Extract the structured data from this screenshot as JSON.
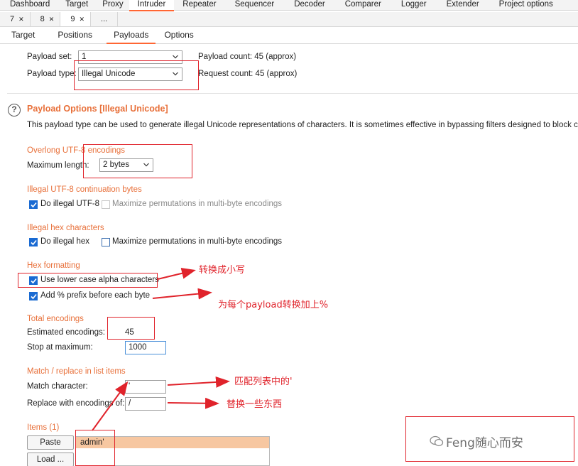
{
  "top_tabs": [
    "Dashboard",
    "Target",
    "Proxy",
    "Intruder",
    "Repeater",
    "Sequencer",
    "Decoder",
    "Comparer",
    "Logger",
    "Extender",
    "Project options"
  ],
  "num_tabs": [
    "7",
    "8",
    "9",
    "..."
  ],
  "inner_tabs": [
    "Target",
    "Positions",
    "Payloads",
    "Options"
  ],
  "payload_set": {
    "label": "Payload set:",
    "value": "1"
  },
  "payload_type": {
    "label": "Payload type:",
    "value": "Illegal Unicode"
  },
  "payload_count": "Payload count:  45 (approx)",
  "request_count": "Request count:  45 (approx)",
  "options": {
    "title": "Payload Options [Illegal Unicode]",
    "description": "This payload type can be used to generate illegal Unicode representations of characters. It is sometimes effective in bypassing filters designed to block certai"
  },
  "overlong": {
    "heading": "Overlong UTF-8 encodings",
    "max_label": "Maximum length:",
    "max_value": "2 bytes"
  },
  "continuation": {
    "heading": "Illegal UTF-8 continuation bytes",
    "do_label": "Do illegal UTF-8",
    "max_perm_label": "Maximize permutations in multi-byte encodings"
  },
  "hex_chars": {
    "heading": "Illegal hex characters",
    "do_label": "Do illegal hex",
    "max_perm_label": "Maximize permutations in multi-byte encodings"
  },
  "hex_format": {
    "heading": "Hex formatting",
    "lower_label": "Use lower case alpha characters",
    "prefix_label": "Add % prefix before each byte"
  },
  "total": {
    "heading": "Total encodings",
    "estimated_label": "Estimated encodings:",
    "estimated_value": "45",
    "stop_label": "Stop at maximum:",
    "stop_value": "1000"
  },
  "match": {
    "heading": "Match / replace in list items",
    "match_label": "Match character:",
    "match_value": "'",
    "replace_label": "Replace with encodings of:",
    "replace_value": "/"
  },
  "items": {
    "heading": "Items (1)",
    "paste_label": "Paste",
    "load_label": "Load ...",
    "rows": [
      "admin'"
    ]
  },
  "annotations": {
    "lowercase": "转换成小写",
    "prefix": "为每个payload转换加上%",
    "match": "匹配列表中的'",
    "replace": "替换一些东西"
  },
  "watermark": "Feng随心而安",
  "colors": {
    "accent": "#ff6633",
    "annotation_red": "#e0232b",
    "section_orange": "#e8703a",
    "checkbox_blue": "#1a6ad2"
  }
}
